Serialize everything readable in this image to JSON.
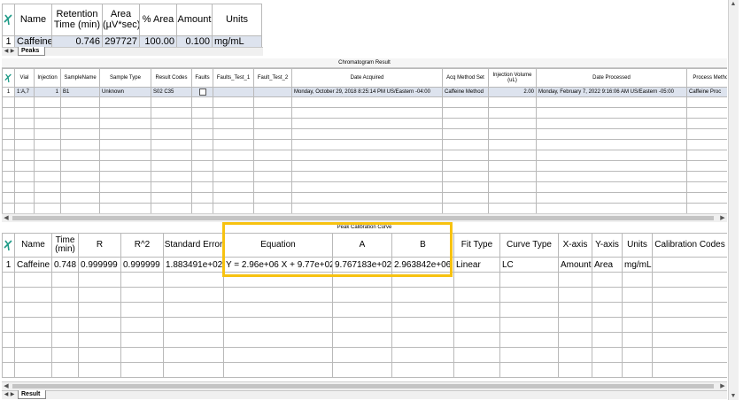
{
  "peaks": {
    "headers": [
      "Name",
      "Retention Time (min)",
      "Area (µV*sec)",
      "% Area",
      "Amount",
      "Units"
    ],
    "row": {
      "num": "1",
      "cells": [
        "Caffeine",
        "0.746",
        "297727",
        "100.00",
        "0.100",
        "mg/mL"
      ]
    },
    "tab_label": "Peaks"
  },
  "chromatogram": {
    "title": "Chromatogram Result",
    "headers": [
      "Vial",
      "Injection",
      "SampleName",
      "Sample Type",
      "Result Codes",
      "Faults",
      "Faults_Test_1",
      "Fault_Test_2",
      "Date Acquired",
      "Acq Method Set",
      "Injection Volume (uL)",
      "Date Processed",
      "Process Method"
    ],
    "header_date_processed": "Date\nProcessed",
    "header_process_method": "Process\nMethod",
    "row": {
      "num": "1",
      "cells": [
        "1:A,7",
        "1",
        "B1",
        "Unknown",
        "S02 C35",
        "",
        "",
        "",
        "Monday, October 29, 2018 8:25:14 PM US/Eastern -04:00",
        "Caffeine Method",
        "2.00",
        "Monday, February 7, 2022 9:16:06 AM US/Eastern -05:00",
        "Caffeine Proc"
      ]
    }
  },
  "calibration": {
    "title": "Peak Calibration Curve",
    "headers": [
      "Name",
      "Time (min)",
      "R",
      "R^2",
      "Standard Error",
      "Equation",
      "A",
      "B",
      "Fit Type",
      "Curve Type",
      "X-axis",
      "Y-axis",
      "Units",
      "Calibration Codes"
    ],
    "row": {
      "num": "1",
      "cells": [
        "Caffeine",
        "0.748",
        "0.999999",
        "0.999999",
        "1.883491e+02",
        "Y = 2.96e+06 X + 9.77e+02",
        "9.767183e+02",
        "2.963842e+06",
        "Linear",
        "LC",
        "Amount",
        "Area",
        "mg/mL",
        ""
      ]
    },
    "tab_label": "Result"
  },
  "colors": {
    "highlight": "#f7c210",
    "selected_row": "#dde3ee",
    "corner_icon": "#1d9a86"
  }
}
